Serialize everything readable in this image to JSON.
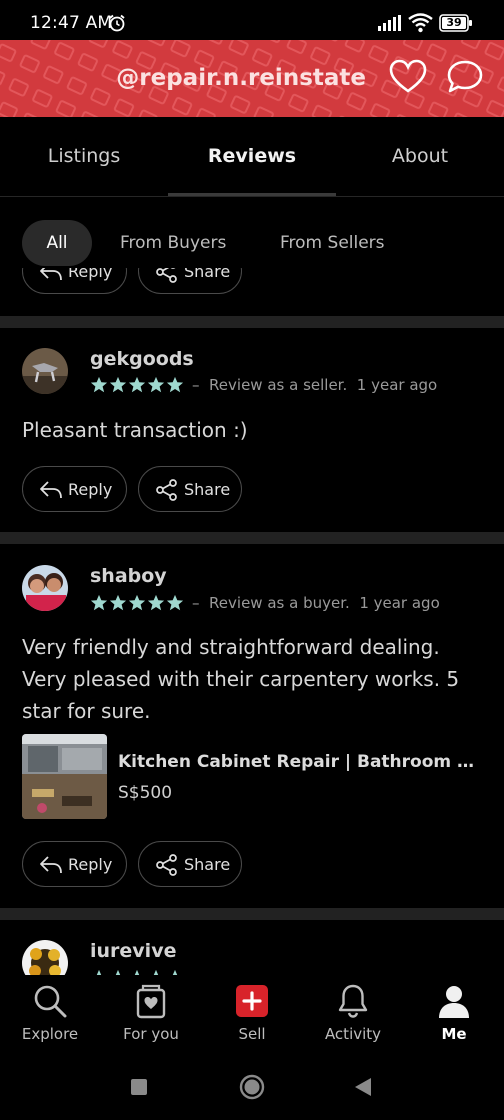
{
  "status_bar": {
    "time": "12:47 AM",
    "battery": "39"
  },
  "header": {
    "title": "@repair.n.reinstate",
    "brand_color": "#d23a3e"
  },
  "tabs": [
    {
      "label": "Listings",
      "active": false
    },
    {
      "label": "Reviews",
      "active": true
    },
    {
      "label": "About",
      "active": false
    }
  ],
  "filters": [
    {
      "label": "All",
      "active": true
    },
    {
      "label": "From Buyers",
      "active": false
    },
    {
      "label": "From Sellers",
      "active": false
    }
  ],
  "partial_top_buttons": {
    "reply": "Reply",
    "share": "Share"
  },
  "reviews": [
    {
      "username": "gekgoods",
      "rating": 5,
      "dash": "–",
      "role": "Review as a seller.",
      "time": "1 year ago",
      "text": "Pleasant transaction :)",
      "reply_label": "Reply",
      "share_label": "Share"
    },
    {
      "username": "shaboy",
      "rating": 5,
      "dash": "–",
      "role": "Review as a buyer.",
      "time": "1 year ago",
      "text": "Very friendly and straightforward dealing. Very pleased with their carpentery works. 5 star for sure.",
      "listing": {
        "title": "Kitchen Cabinet Repair | Bathroom Va...",
        "price": "S$500"
      },
      "reply_label": "Reply",
      "share_label": "Share"
    },
    {
      "username": "iurevive",
      "rating": 5
    }
  ],
  "bottom_nav": [
    {
      "label": "Explore",
      "icon": "search-icon",
      "active": false
    },
    {
      "label": "For you",
      "icon": "for-you-icon",
      "active": false
    },
    {
      "label": "Sell",
      "icon": "sell-plus-icon",
      "active": false
    },
    {
      "label": "Activity",
      "icon": "bell-icon",
      "active": false
    },
    {
      "label": "Me",
      "icon": "profile-icon",
      "active": true
    }
  ],
  "colors": {
    "star": "#9fd8cf",
    "sell": "#d8232a"
  }
}
